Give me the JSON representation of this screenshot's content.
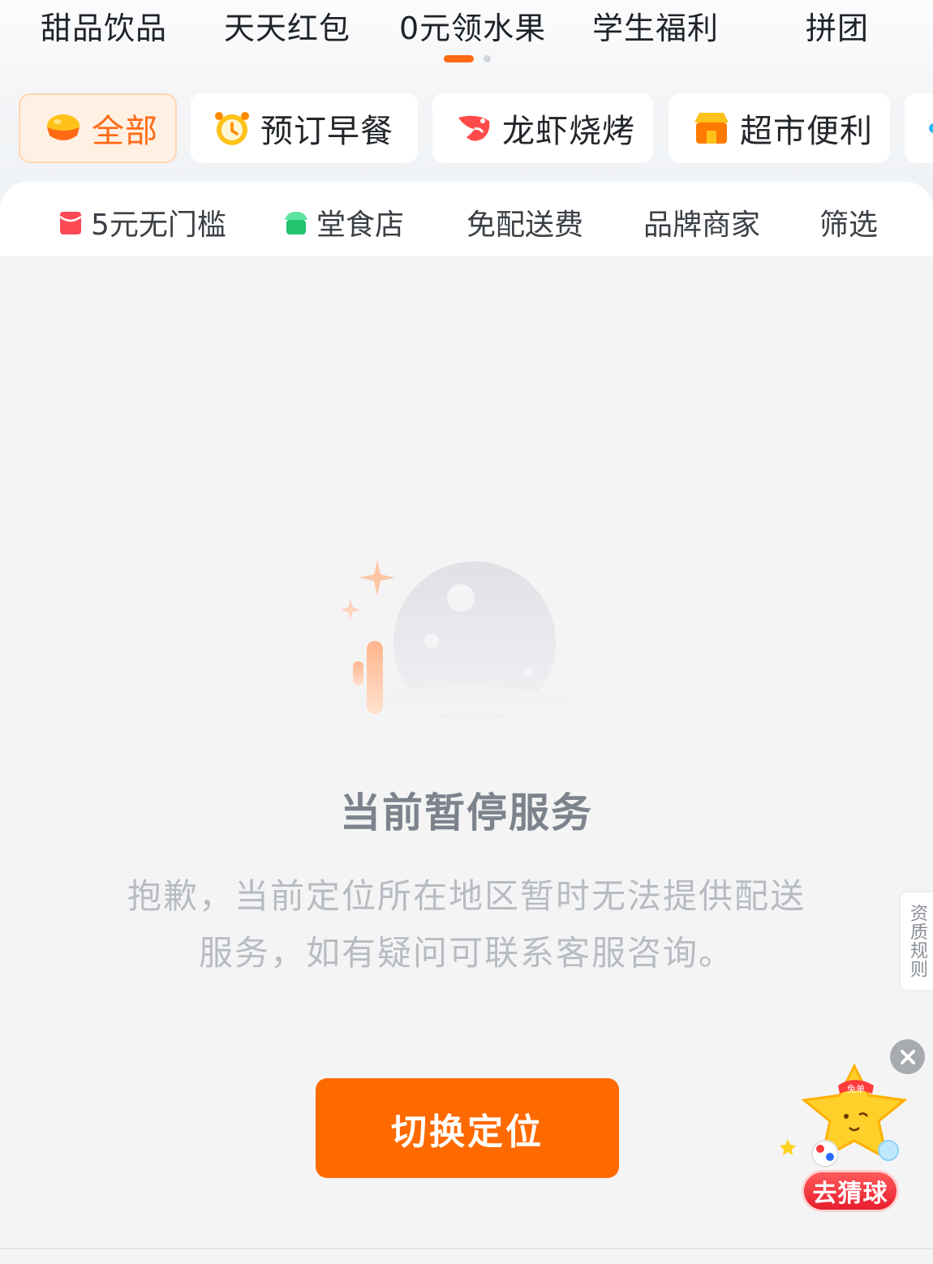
{
  "top_categories": [
    "甜品饮品",
    "天天红包",
    "0元领水果",
    "学生福利",
    "拼团"
  ],
  "pills": [
    {
      "label": "全部",
      "icon": "bowl-icon",
      "active": true
    },
    {
      "label": "预订早餐",
      "icon": "alarm-clock-icon",
      "active": false
    },
    {
      "label": "龙虾烧烤",
      "icon": "shrimp-icon",
      "active": false
    },
    {
      "label": "超市便利",
      "icon": "store-icon",
      "active": false
    }
  ],
  "filters": [
    {
      "label": "5元无门槛",
      "icon": "red-packet-icon"
    },
    {
      "label": "堂食店",
      "icon": "shop-icon"
    },
    {
      "label": "免配送费"
    },
    {
      "label": "品牌商家"
    },
    {
      "label": "筛选"
    }
  ],
  "empty_state": {
    "title": "当前暂停服务",
    "description": "抱歉，当前定位所在地区暂时无法提供配送服务，如有疑问可联系客服咨询。",
    "button_label": "切换定位"
  },
  "side_tab": {
    "label": "资质规则"
  },
  "promo": {
    "button_label": "去猜球",
    "badge": "免单"
  },
  "colors": {
    "accent": "#ff6a00",
    "active_pill_bg": "#fff0e4",
    "page_bg": "#f4f4f5"
  }
}
